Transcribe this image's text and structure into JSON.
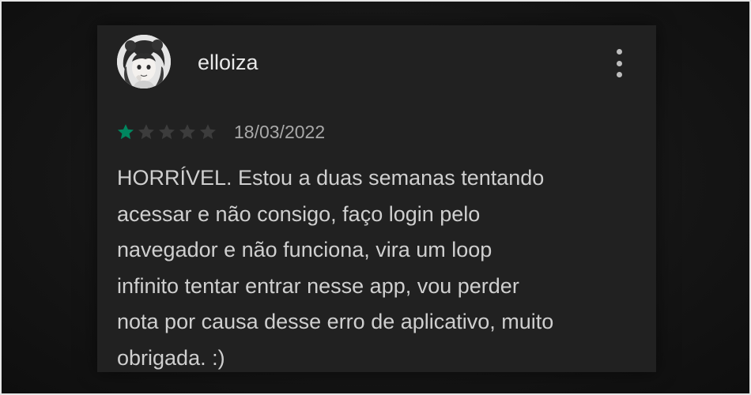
{
  "review": {
    "username": "elloiza",
    "date": "18/03/2022",
    "rating": 1,
    "max_rating": 5,
    "text": "HORRÍVEL. Estou a duas semanas tentando\nacessar e não consigo, faço login pelo\nnavegador e não funciona, vira um loop\ninfinito tentar entrar nesse app, vou perder\nnota por causa desse erro de aplicativo, muito\nobrigada. :)"
  },
  "icons": {
    "menu": "more-vert-icon",
    "star": "star-icon",
    "avatar": "user-avatar"
  },
  "colors": {
    "star_filled": "#01875f",
    "star_empty": "#3c3c3c",
    "card_background": "#212121",
    "page_background": "#161616",
    "text_primary": "#e8e8e8",
    "text_secondary": "#a9a9a9"
  }
}
